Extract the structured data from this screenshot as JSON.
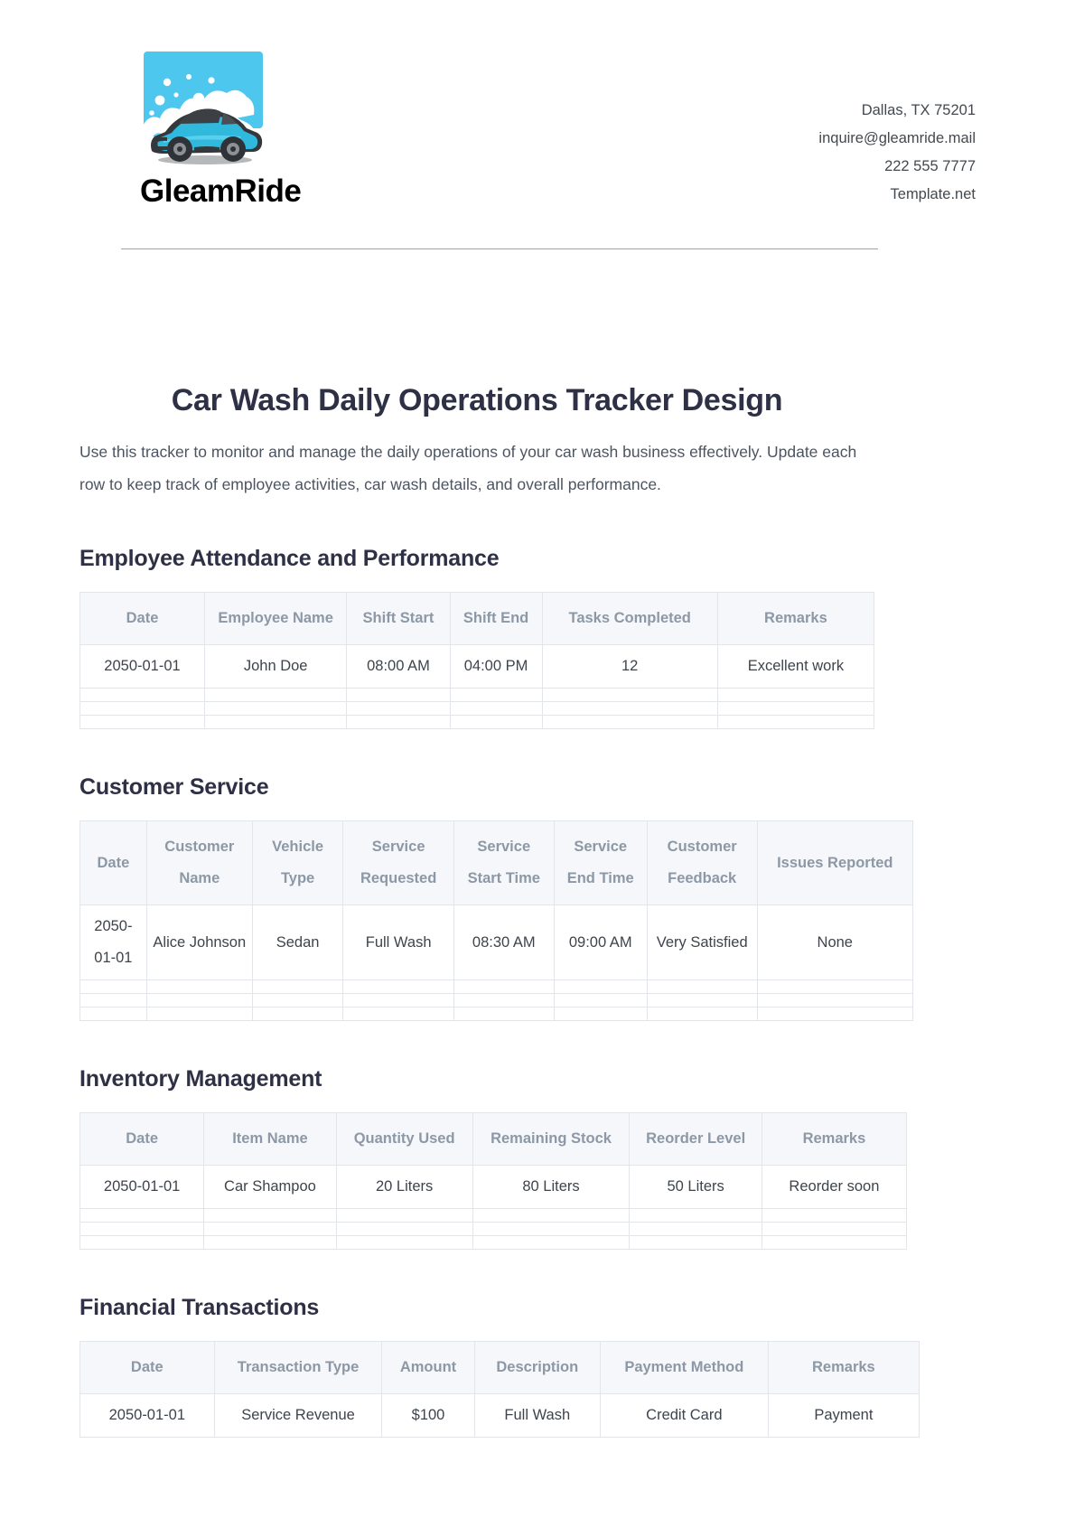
{
  "brand": {
    "name": "GleamRide",
    "logo_icon": "car-wash-logo-icon"
  },
  "contact": {
    "address": "Dallas, TX 75201",
    "email": "inquire@gleamride.mail",
    "phone": "222 555 7777",
    "website": "Template.net"
  },
  "document": {
    "title": "Car Wash Daily Operations Tracker Design",
    "intro": "Use this tracker to monitor and manage the daily operations of your car wash business effectively. Update each row to keep track of employee activities, car wash details, and overall performance."
  },
  "colors": {
    "accent": "#3fc5ef",
    "heading": "#2e3045",
    "table_header_bg": "#f5f7fa",
    "table_header_text": "#8d98a6",
    "table_border": "#e2e5e9",
    "body_text": "#4c5462"
  },
  "sections": [
    {
      "id": "employee-attendance-and-performance",
      "title": "Employee Attendance and Performance",
      "columns": [
        "Date",
        "Employee Name",
        "Shift Start",
        "Shift End",
        "Tasks Completed",
        "Remarks"
      ],
      "rows": [
        [
          "2050-01-01",
          "John Doe",
          "08:00 AM",
          "04:00 PM",
          "12",
          "Excellent work"
        ]
      ],
      "empty_rows": 3
    },
    {
      "id": "customer-service",
      "title": "Customer Service",
      "columns": [
        "Date",
        "Customer Name",
        "Vehicle Type",
        "Service Requested",
        "Service Start Time",
        "Service End Time",
        "Customer Feedback",
        "Issues Reported"
      ],
      "rows": [
        [
          "2050-01-01",
          "Alice Johnson",
          "Sedan",
          "Full Wash",
          "08:30 AM",
          "09:00 AM",
          "Very Satisfied",
          "None"
        ]
      ],
      "empty_rows": 3
    },
    {
      "id": "inventory-management",
      "title": "Inventory Management",
      "columns": [
        "Date",
        "Item Name",
        "Quantity Used",
        "Remaining Stock",
        "Reorder Level",
        "Remarks"
      ],
      "rows": [
        [
          "2050-01-01",
          "Car Shampoo",
          "20 Liters",
          "80 Liters",
          "50 Liters",
          "Reorder soon"
        ]
      ],
      "empty_rows": 3
    },
    {
      "id": "financial-transactions",
      "title": "Financial Transactions",
      "columns": [
        "Date",
        "Transaction Type",
        "Amount",
        "Description",
        "Payment Method",
        "Remarks"
      ],
      "rows": [
        [
          "2050-01-01",
          "Service Revenue",
          "$100",
          "Full Wash",
          "Credit Card",
          "Payment"
        ]
      ],
      "empty_rows": 0
    }
  ]
}
